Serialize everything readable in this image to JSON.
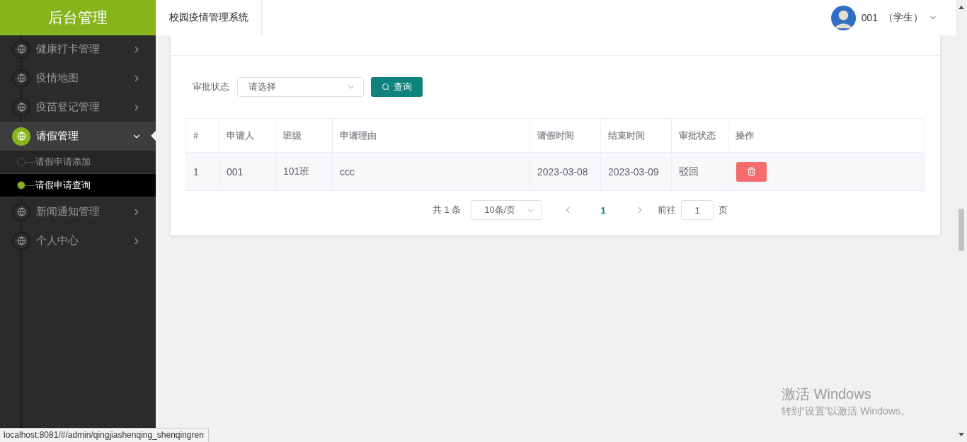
{
  "sidebar": {
    "title": "后台管理",
    "menu": [
      {
        "label": "健康打卡管理",
        "expanded": false,
        "selected": false
      },
      {
        "label": "疫情地图",
        "expanded": false,
        "selected": false
      },
      {
        "label": "疫苗登记管理",
        "expanded": false,
        "selected": false
      },
      {
        "label": "请假管理",
        "expanded": true,
        "selected": true,
        "children": [
          {
            "label": "请假申请添加",
            "selected": false
          },
          {
            "label": "请假申请查询",
            "selected": true
          }
        ]
      },
      {
        "label": "新闻通知管理",
        "expanded": false,
        "selected": false
      },
      {
        "label": "个人中心",
        "expanded": false,
        "selected": false
      }
    ]
  },
  "header": {
    "title": "校园疫情管理系统",
    "user": {
      "name": "001",
      "role": "（学生）"
    }
  },
  "card": {
    "filter": {
      "label": "审批状态",
      "placeholder": "请选择",
      "button": "查询"
    },
    "table": {
      "columns": [
        "#",
        "申请人",
        "班级",
        "申请理由",
        "请假时间",
        "结束时间",
        "审批状态",
        "操作"
      ],
      "rows": [
        {
          "cells": [
            "1",
            "001",
            "101班",
            "ccc",
            "2023-03-08",
            "2023-03-09",
            "驳回"
          ]
        }
      ]
    },
    "pagination": {
      "total": "共 1 条",
      "page_size": "10条/页",
      "pages": [
        {
          "label": "1",
          "selected": true
        }
      ],
      "goto_label": "前往",
      "goto_value": "1",
      "page_suffix": "页"
    }
  },
  "status_bar": "localhost:8081/#/admin/qingjiashenqing_shenqingren",
  "os_notice": {
    "title": "激活 Windows",
    "text": "转到“设置”以激活 Windows。"
  }
}
